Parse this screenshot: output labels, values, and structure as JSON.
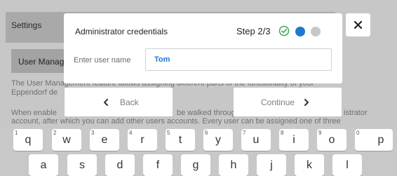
{
  "background": {
    "header_title": "Settings",
    "subtab": "User Manag",
    "text_lines": [
      "The User Management feature allows assigning different parts of the functionality of your",
      "Eppendorf de",
      "When enable",
      "be walked through",
      "istrator",
      "account, after which you can add other users accounts. Every user can be assigned one of three"
    ]
  },
  "dialog": {
    "title": "Administrator credentials",
    "step_label": "Step 2/3",
    "user_label": "Enter user name",
    "user_value": "Tom"
  },
  "nav": {
    "back_label": "Back",
    "continue_label": "Continue"
  },
  "keyboard": {
    "row1": [
      {
        "ch": "q",
        "num": "1"
      },
      {
        "ch": "w",
        "num": "2"
      },
      {
        "ch": "e",
        "num": "3"
      },
      {
        "ch": "r",
        "num": "4"
      },
      {
        "ch": "t",
        "num": "5"
      },
      {
        "ch": "y",
        "num": "6"
      },
      {
        "ch": "u",
        "num": "7"
      },
      {
        "ch": "i",
        "num": "8"
      },
      {
        "ch": "o",
        "num": "9"
      },
      {
        "ch": "p",
        "num": "0"
      }
    ],
    "row2": [
      "a",
      "s",
      "d",
      "f",
      "g",
      "h",
      "j",
      "k",
      "l"
    ]
  },
  "colors": {
    "accent": "#1f78d1",
    "check": "#3aa655",
    "inactive_dot": "#c7c7c7"
  },
  "icons": [
    "check-circle-icon",
    "close-icon",
    "chevron-left-icon",
    "chevron-right-icon"
  ]
}
